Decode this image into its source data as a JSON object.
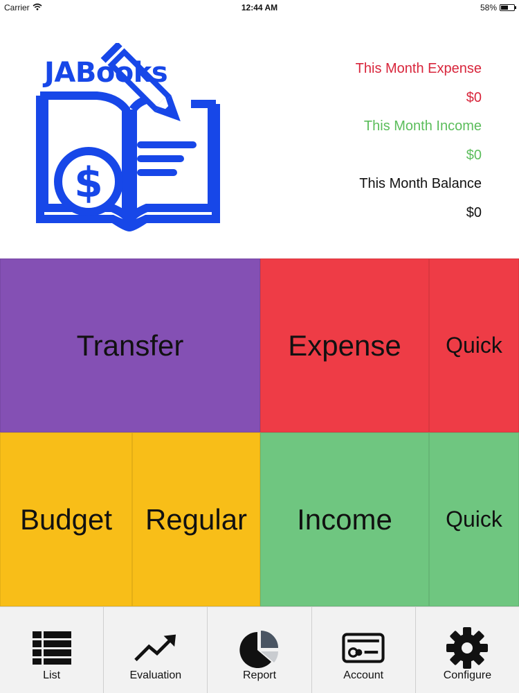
{
  "status_bar": {
    "carrier": "Carrier",
    "time": "12:44 AM",
    "battery": "58%",
    "battery_level": 0.58
  },
  "logo": {
    "text": "JABooks",
    "color": "#1747e8",
    "icon": "book-pencil-dollar-logo"
  },
  "summary": {
    "expense_label": "This Month Expense",
    "expense_value": "$0",
    "income_label": "This Month Income",
    "income_value": "$0",
    "balance_label": "This Month Balance",
    "balance_value": "$0",
    "colors": {
      "expense": "#d8253b",
      "income": "#5bbd5b",
      "balance": "#111111"
    }
  },
  "tiles": {
    "transfer": "Transfer",
    "expense": "Expense",
    "quick_expense": "Quick",
    "budget": "Budget",
    "regular": "Regular",
    "income": "Income",
    "quick_income": "Quick",
    "colors": {
      "transfer": "#8450b4",
      "expense": "#ee3c46",
      "budget": "#f8be18",
      "income": "#6fc680"
    }
  },
  "tabbar": {
    "items": [
      {
        "label": "List",
        "icon": "list-icon"
      },
      {
        "label": "Evaluation",
        "icon": "trend-up-icon"
      },
      {
        "label": "Report",
        "icon": "pie-chart-icon"
      },
      {
        "label": "Account",
        "icon": "id-card-icon"
      },
      {
        "label": "Configure",
        "icon": "gear-icon"
      }
    ]
  }
}
